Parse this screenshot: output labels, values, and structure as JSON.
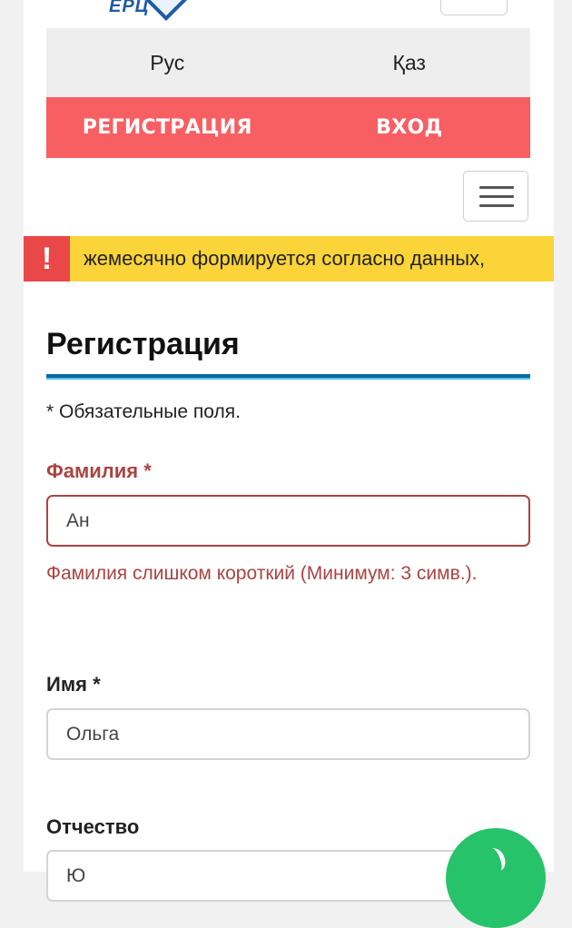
{
  "logo": {
    "text": "ЕРЦ"
  },
  "languages": [
    "Рус",
    "Қаз"
  ],
  "auth": {
    "register": "РЕГИСТРАЦИЯ",
    "login": "ВХОД"
  },
  "alert": {
    "icon": "!",
    "text": "жемесячно формируется согласно данных,"
  },
  "form": {
    "title": "Регистрация",
    "required_note": "* Обязательные поля.",
    "fields": [
      {
        "label": "Фамилия",
        "required_mark": "*",
        "value": "Ан",
        "error": "Фамилия слишком короткий (Минимум: 3 симв.)."
      },
      {
        "label": "Имя",
        "required_mark": "*",
        "value": "Ольга"
      },
      {
        "label": "Отчество",
        "value": "Ю"
      }
    ]
  },
  "colors": {
    "auth_bar": "#f75f63",
    "alert_bg": "#fbd43a",
    "alert_icon_bg": "#ea4848",
    "error": "#a94442",
    "title_rule": "#0e6aa3",
    "fab": "#27c36b"
  },
  "icons": {
    "menu": "hamburger-icon",
    "alert": "exclamation-icon",
    "fab": "leaf-icon"
  }
}
